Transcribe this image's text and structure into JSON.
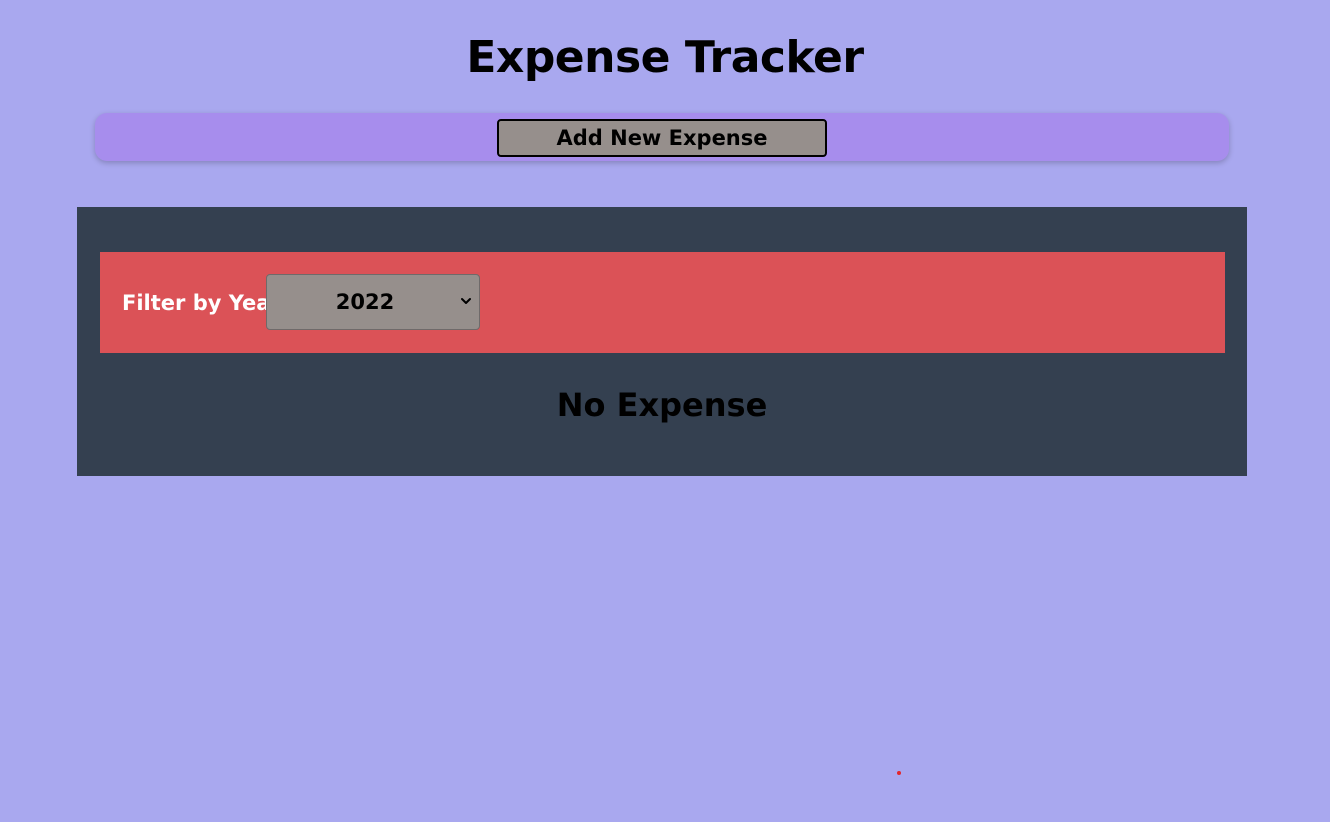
{
  "header": {
    "title": "Expense Tracker"
  },
  "toolbar": {
    "add_label": "Add New Expense"
  },
  "filter": {
    "label": "Filter by Year",
    "selected_year": "2022",
    "chevron_icon": "chevron-down-icon"
  },
  "expenses": {
    "empty_message": "No Expense"
  },
  "colors": {
    "page_background": "#a9a8ef",
    "add_bar": "#a78ded",
    "button": "#968f8c",
    "panel": "#344050",
    "filter_bar": "#db5257"
  }
}
